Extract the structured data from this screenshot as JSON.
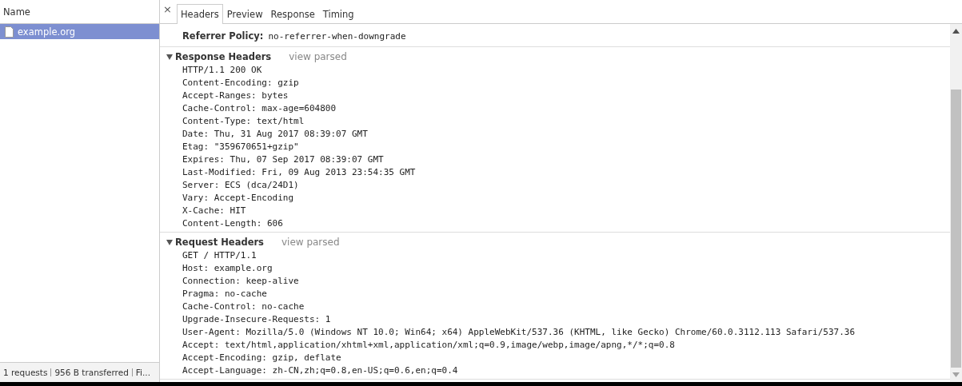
{
  "sidebar": {
    "column": "Name",
    "items": [
      {
        "name": "example.org",
        "selected": true
      }
    ]
  },
  "status_bar": [
    "1 requests",
    "956 B transferred",
    "Fi..."
  ],
  "details": {
    "close": "×",
    "tabs": [
      {
        "label": "Headers",
        "selected": true
      },
      {
        "label": "Preview",
        "selected": false
      },
      {
        "label": "Response",
        "selected": false
      },
      {
        "label": "Timing",
        "selected": false
      }
    ],
    "general": [
      {
        "label": "Referrer Policy:",
        "value": "no-referrer-when-downgrade"
      }
    ],
    "sections": [
      {
        "title": "Response Headers",
        "expanded": true,
        "toggle": "view parsed",
        "lines": [
          "HTTP/1.1 200 OK",
          "Content-Encoding: gzip",
          "Accept-Ranges: bytes",
          "Cache-Control: max-age=604800",
          "Content-Type: text/html",
          "Date: Thu, 31 Aug 2017 08:39:07 GMT",
          "Etag: \"359670651+gzip\"",
          "Expires: Thu, 07 Sep 2017 08:39:07 GMT",
          "Last-Modified: Fri, 09 Aug 2013 23:54:35 GMT",
          "Server: ECS (dca/24D1)",
          "Vary: Accept-Encoding",
          "X-Cache: HIT",
          "Content-Length: 606"
        ]
      },
      {
        "title": "Request Headers",
        "expanded": true,
        "toggle": "view parsed",
        "lines": [
          "GET / HTTP/1.1",
          "Host: example.org",
          "Connection: keep-alive",
          "Pragma: no-cache",
          "Cache-Control: no-cache",
          "Upgrade-Insecure-Requests: 1",
          "User-Agent: Mozilla/5.0 (Windows NT 10.0; Win64; x64) AppleWebKit/537.36 (KHTML, like Gecko) Chrome/60.0.3112.113 Safari/537.36",
          "Accept: text/html,application/xhtml+xml,application/xml;q=0.9,image/webp,image/apng,*/*;q=0.8",
          "Accept-Encoding: gzip, deflate",
          "Accept-Language: zh-CN,zh;q=0.8,en-US;q=0.6,en;q=0.4"
        ]
      }
    ]
  }
}
